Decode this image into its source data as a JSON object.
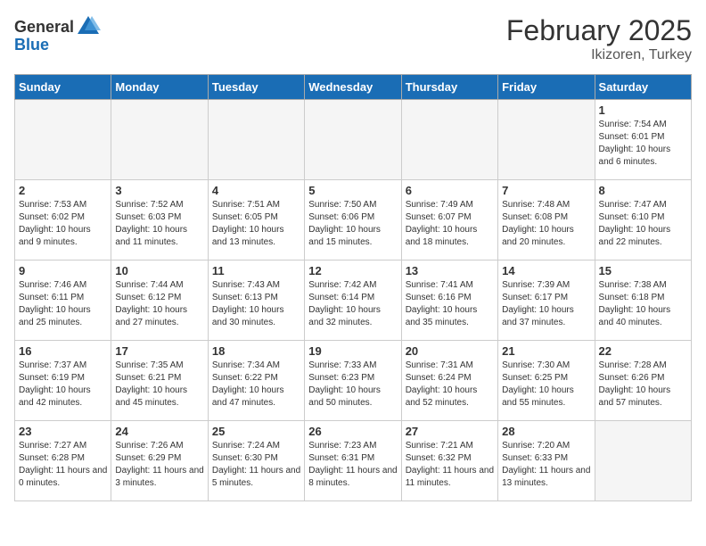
{
  "header": {
    "logo_general": "General",
    "logo_blue": "Blue",
    "month_title": "February 2025",
    "location": "Ikizoren, Turkey"
  },
  "weekdays": [
    "Sunday",
    "Monday",
    "Tuesday",
    "Wednesday",
    "Thursday",
    "Friday",
    "Saturday"
  ],
  "weeks": [
    [
      {
        "day": "",
        "empty": true
      },
      {
        "day": "",
        "empty": true
      },
      {
        "day": "",
        "empty": true
      },
      {
        "day": "",
        "empty": true
      },
      {
        "day": "",
        "empty": true
      },
      {
        "day": "",
        "empty": true
      },
      {
        "day": "1",
        "sunrise": "7:54 AM",
        "sunset": "6:01 PM",
        "daylight": "10 hours and 6 minutes."
      }
    ],
    [
      {
        "day": "2",
        "sunrise": "7:53 AM",
        "sunset": "6:02 PM",
        "daylight": "10 hours and 9 minutes."
      },
      {
        "day": "3",
        "sunrise": "7:52 AM",
        "sunset": "6:03 PM",
        "daylight": "10 hours and 11 minutes."
      },
      {
        "day": "4",
        "sunrise": "7:51 AM",
        "sunset": "6:05 PM",
        "daylight": "10 hours and 13 minutes."
      },
      {
        "day": "5",
        "sunrise": "7:50 AM",
        "sunset": "6:06 PM",
        "daylight": "10 hours and 15 minutes."
      },
      {
        "day": "6",
        "sunrise": "7:49 AM",
        "sunset": "6:07 PM",
        "daylight": "10 hours and 18 minutes."
      },
      {
        "day": "7",
        "sunrise": "7:48 AM",
        "sunset": "6:08 PM",
        "daylight": "10 hours and 20 minutes."
      },
      {
        "day": "8",
        "sunrise": "7:47 AM",
        "sunset": "6:10 PM",
        "daylight": "10 hours and 22 minutes."
      }
    ],
    [
      {
        "day": "9",
        "sunrise": "7:46 AM",
        "sunset": "6:11 PM",
        "daylight": "10 hours and 25 minutes."
      },
      {
        "day": "10",
        "sunrise": "7:44 AM",
        "sunset": "6:12 PM",
        "daylight": "10 hours and 27 minutes."
      },
      {
        "day": "11",
        "sunrise": "7:43 AM",
        "sunset": "6:13 PM",
        "daylight": "10 hours and 30 minutes."
      },
      {
        "day": "12",
        "sunrise": "7:42 AM",
        "sunset": "6:14 PM",
        "daylight": "10 hours and 32 minutes."
      },
      {
        "day": "13",
        "sunrise": "7:41 AM",
        "sunset": "6:16 PM",
        "daylight": "10 hours and 35 minutes."
      },
      {
        "day": "14",
        "sunrise": "7:39 AM",
        "sunset": "6:17 PM",
        "daylight": "10 hours and 37 minutes."
      },
      {
        "day": "15",
        "sunrise": "7:38 AM",
        "sunset": "6:18 PM",
        "daylight": "10 hours and 40 minutes."
      }
    ],
    [
      {
        "day": "16",
        "sunrise": "7:37 AM",
        "sunset": "6:19 PM",
        "daylight": "10 hours and 42 minutes."
      },
      {
        "day": "17",
        "sunrise": "7:35 AM",
        "sunset": "6:21 PM",
        "daylight": "10 hours and 45 minutes."
      },
      {
        "day": "18",
        "sunrise": "7:34 AM",
        "sunset": "6:22 PM",
        "daylight": "10 hours and 47 minutes."
      },
      {
        "day": "19",
        "sunrise": "7:33 AM",
        "sunset": "6:23 PM",
        "daylight": "10 hours and 50 minutes."
      },
      {
        "day": "20",
        "sunrise": "7:31 AM",
        "sunset": "6:24 PM",
        "daylight": "10 hours and 52 minutes."
      },
      {
        "day": "21",
        "sunrise": "7:30 AM",
        "sunset": "6:25 PM",
        "daylight": "10 hours and 55 minutes."
      },
      {
        "day": "22",
        "sunrise": "7:28 AM",
        "sunset": "6:26 PM",
        "daylight": "10 hours and 57 minutes."
      }
    ],
    [
      {
        "day": "23",
        "sunrise": "7:27 AM",
        "sunset": "6:28 PM",
        "daylight": "11 hours and 0 minutes."
      },
      {
        "day": "24",
        "sunrise": "7:26 AM",
        "sunset": "6:29 PM",
        "daylight": "11 hours and 3 minutes."
      },
      {
        "day": "25",
        "sunrise": "7:24 AM",
        "sunset": "6:30 PM",
        "daylight": "11 hours and 5 minutes."
      },
      {
        "day": "26",
        "sunrise": "7:23 AM",
        "sunset": "6:31 PM",
        "daylight": "11 hours and 8 minutes."
      },
      {
        "day": "27",
        "sunrise": "7:21 AM",
        "sunset": "6:32 PM",
        "daylight": "11 hours and 11 minutes."
      },
      {
        "day": "28",
        "sunrise": "7:20 AM",
        "sunset": "6:33 PM",
        "daylight": "11 hours and 13 minutes."
      },
      {
        "day": "",
        "empty": true
      }
    ]
  ],
  "labels": {
    "sunrise": "Sunrise:",
    "sunset": "Sunset:",
    "daylight": "Daylight:"
  }
}
